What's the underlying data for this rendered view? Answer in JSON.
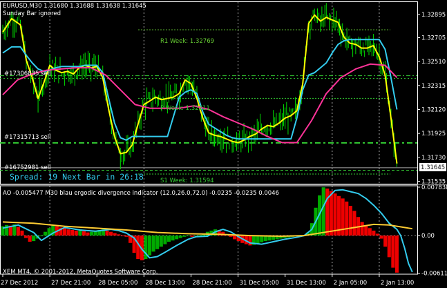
{
  "header": {
    "symbol_line": "EURUSD,M30  1.31680 1.31688 1.31638 1.31645",
    "subtitle": "Sunday Bar ignored"
  },
  "colors": {
    "background": "#000000",
    "grid": "#ffffff",
    "price_bars": "#00dd00",
    "yellow_ma": "#ffff00",
    "cyan_line": "#33ccee",
    "pink_ma": "#ff3399",
    "level_green": "#33cc33",
    "text": "#ffffff",
    "spread_text": "#33ccee",
    "hist_up": "#00aa00",
    "hist_down": "#ee0000",
    "ind_cyan": "#33ccee",
    "ind_yellow": "#ffcc33"
  },
  "labels": {
    "r1_week": "R1 Week: 1.32769",
    "pivot_week": "P Week: 1.32211",
    "s_week": "S1 Week: 1.31594",
    "order1": "#17306835 sell",
    "order2": "#17315713 sell",
    "order3": "#16752981 sell",
    "spread": "Spread: 19  Next Bar in 26:18",
    "current_price": "1.31645"
  },
  "indicator": {
    "title": "AO -0.005477  M30 blau ergodic divergence indicator (12.0,26.0,72.0) -0.0235 -0.0235 0.0046",
    "copyright": "XEM MT4, © 2001-2012, MetaQuotes Software Corp."
  },
  "chart_data": {
    "type": "line",
    "price_axis": {
      "ylim": [
        1.31515,
        1.32995
      ],
      "ticks": [
        {
          "value": 1.32895,
          "label": "1.32895"
        },
        {
          "value": 1.32705,
          "label": "1.32705"
        },
        {
          "value": 1.3251,
          "label": "1.32510"
        },
        {
          "value": 1.32315,
          "label": "1.32315"
        },
        {
          "value": 1.3212,
          "label": "1.32120"
        },
        {
          "value": 1.31925,
          "label": "1.31925"
        },
        {
          "value": 1.3173,
          "label": "1.31730"
        },
        {
          "value": 1.31535,
          "label": "1.31535"
        }
      ]
    },
    "time_axis": {
      "ticks": [
        {
          "t": 0,
          "label": "27 Dec 2012"
        },
        {
          "t": 16,
          "label": "27 Dec 21:00"
        },
        {
          "t": 32,
          "label": "28 Dec 05:00"
        },
        {
          "t": 48,
          "label": "28 Dec 13:00"
        },
        {
          "t": 64,
          "label": "28 Dec 21:00"
        },
        {
          "t": 80,
          "label": "31 Dec 05:00"
        },
        {
          "t": 96,
          "label": "31 Dec 13:00"
        },
        {
          "t": 112,
          "label": "2 Jan 05:00"
        },
        {
          "t": 128,
          "label": "2 Jan 13:00"
        }
      ],
      "vgrid": [
        16,
        48,
        80,
        112,
        128
      ]
    },
    "levels": [
      {
        "name": "r1_week",
        "value": 1.32769
      },
      {
        "name": "pivot_week",
        "value": 1.32211
      },
      {
        "name": "s_week",
        "value": 1.31594
      },
      {
        "name": "order1",
        "value": 1.32395
      },
      {
        "name": "order2",
        "value": 1.31848
      },
      {
        "name": "order3",
        "value": 1.31625
      },
      {
        "name": "current_price",
        "value": 1.31645
      }
    ],
    "price_series": [
      {
        "name": "yellow_ma",
        "points": [
          [
            0,
            1.3275
          ],
          [
            3,
            1.3286
          ],
          [
            6,
            1.3281
          ],
          [
            8,
            1.3252
          ],
          [
            10,
            1.3238
          ],
          [
            12,
            1.3221
          ],
          [
            14,
            1.3234
          ],
          [
            16,
            1.3248
          ],
          [
            18,
            1.3244
          ],
          [
            20,
            1.3242
          ],
          [
            22,
            1.3243
          ],
          [
            24,
            1.3241
          ],
          [
            26,
            1.3246
          ],
          [
            28,
            1.3248
          ],
          [
            30,
            1.3246
          ],
          [
            32,
            1.3247
          ],
          [
            34,
            1.3238
          ],
          [
            36,
            1.3212
          ],
          [
            38,
            1.319
          ],
          [
            40,
            1.3176
          ],
          [
            42,
            1.3177
          ],
          [
            44,
            1.3183
          ],
          [
            46,
            1.32
          ],
          [
            48,
            1.3216
          ],
          [
            50,
            1.3219
          ],
          [
            52,
            1.3222
          ],
          [
            54,
            1.322
          ],
          [
            56,
            1.3221
          ],
          [
            58,
            1.3222
          ],
          [
            60,
            1.3225
          ],
          [
            62,
            1.3236
          ],
          [
            64,
            1.3233
          ],
          [
            66,
            1.3221
          ],
          [
            68,
            1.3205
          ],
          [
            70,
            1.3193
          ],
          [
            72,
            1.3191
          ],
          [
            74,
            1.319
          ],
          [
            76,
            1.3188
          ],
          [
            78,
            1.3186
          ],
          [
            80,
            1.3185
          ],
          [
            82,
            1.3187
          ],
          [
            84,
            1.319
          ],
          [
            86,
            1.3192
          ],
          [
            88,
            1.3196
          ],
          [
            90,
            1.3199
          ],
          [
            92,
            1.3198
          ],
          [
            94,
            1.3201
          ],
          [
            96,
            1.3205
          ],
          [
            98,
            1.3207
          ],
          [
            100,
            1.3211
          ],
          [
            102,
            1.3233
          ],
          [
            104,
            1.3282
          ],
          [
            106,
            1.3289
          ],
          [
            108,
            1.3284
          ],
          [
            110,
            1.3287
          ],
          [
            112,
            1.3285
          ],
          [
            114,
            1.3283
          ],
          [
            116,
            1.3271
          ],
          [
            118,
            1.3266
          ],
          [
            120,
            1.3265
          ],
          [
            122,
            1.3262
          ],
          [
            124,
            1.3262
          ],
          [
            126,
            1.3264
          ],
          [
            128,
            1.3255
          ],
          [
            130,
            1.324
          ],
          [
            132,
            1.3205
          ],
          [
            134,
            1.3168
          ]
        ]
      },
      {
        "name": "cyan_line",
        "points": [
          [
            0,
            1.3258
          ],
          [
            3,
            1.3263
          ],
          [
            6,
            1.3263
          ],
          [
            8,
            1.3256
          ],
          [
            10,
            1.325
          ],
          [
            12,
            1.3245
          ],
          [
            14,
            1.3243
          ],
          [
            16,
            1.3244
          ],
          [
            18,
            1.3246
          ],
          [
            20,
            1.3247
          ],
          [
            22,
            1.3247
          ],
          [
            24,
            1.3247
          ],
          [
            26,
            1.3247
          ],
          [
            28,
            1.3248
          ],
          [
            30,
            1.3248
          ],
          [
            32,
            1.3248
          ],
          [
            34,
            1.3242
          ],
          [
            36,
            1.3221
          ],
          [
            38,
            1.3201
          ],
          [
            40,
            1.3189
          ],
          [
            42,
            1.3187
          ],
          [
            44,
            1.319
          ],
          [
            46,
            1.319
          ],
          [
            48,
            1.319
          ],
          [
            50,
            1.319
          ],
          [
            52,
            1.319
          ],
          [
            54,
            1.319
          ],
          [
            56,
            1.319
          ],
          [
            58,
            1.3206
          ],
          [
            60,
            1.3222
          ],
          [
            62,
            1.3226
          ],
          [
            64,
            1.3228
          ],
          [
            66,
            1.3225
          ],
          [
            68,
            1.321
          ],
          [
            70,
            1.32
          ],
          [
            72,
            1.3197
          ],
          [
            74,
            1.3194
          ],
          [
            76,
            1.3191
          ],
          [
            78,
            1.3189
          ],
          [
            80,
            1.3188
          ],
          [
            82,
            1.3188
          ],
          [
            84,
            1.3188
          ],
          [
            86,
            1.3188
          ],
          [
            88,
            1.3188
          ],
          [
            90,
            1.3188
          ],
          [
            92,
            1.3188
          ],
          [
            94,
            1.3188
          ],
          [
            96,
            1.3188
          ],
          [
            98,
            1.3188
          ],
          [
            100,
            1.3205
          ],
          [
            102,
            1.3228
          ],
          [
            104,
            1.324
          ],
          [
            106,
            1.3242
          ],
          [
            108,
            1.3246
          ],
          [
            110,
            1.325
          ],
          [
            112,
            1.3258
          ],
          [
            114,
            1.3265
          ],
          [
            116,
            1.3268
          ],
          [
            118,
            1.3269
          ],
          [
            120,
            1.3269
          ],
          [
            122,
            1.3269
          ],
          [
            124,
            1.3269
          ],
          [
            126,
            1.3269
          ],
          [
            128,
            1.3269
          ],
          [
            130,
            1.3261
          ],
          [
            132,
            1.3238
          ],
          [
            134,
            1.3212
          ]
        ]
      },
      {
        "name": "pink_ma",
        "points": [
          [
            0,
            1.3224
          ],
          [
            5,
            1.3236
          ],
          [
            10,
            1.3241
          ],
          [
            15,
            1.3244
          ],
          [
            20,
            1.3245
          ],
          [
            25,
            1.3246
          ],
          [
            30,
            1.3246
          ],
          [
            35,
            1.324
          ],
          [
            40,
            1.3228
          ],
          [
            45,
            1.3216
          ],
          [
            50,
            1.3213
          ],
          [
            55,
            1.3213
          ],
          [
            60,
            1.3213
          ],
          [
            65,
            1.3215
          ],
          [
            70,
            1.3212
          ],
          [
            75,
            1.3206
          ],
          [
            80,
            1.3201
          ],
          [
            85,
            1.3196
          ],
          [
            90,
            1.319
          ],
          [
            95,
            1.3185
          ],
          [
            100,
            1.3185
          ],
          [
            105,
            1.3203
          ],
          [
            110,
            1.3225
          ],
          [
            115,
            1.3238
          ],
          [
            120,
            1.3245
          ],
          [
            125,
            1.3249
          ],
          [
            130,
            1.3248
          ],
          [
            134,
            1.3238
          ]
        ]
      }
    ],
    "indicator_axis": {
      "ylim": [
        -0.00625,
        0.00805
      ],
      "ticks": [
        {
          "value": 0.00783,
          "label": "0.007838"
        },
        {
          "value": 0.0,
          "label": "0.00"
        },
        {
          "value": -0.00611,
          "label": "-0.006111"
        }
      ]
    },
    "indicator_histogram": {
      "name": "AO",
      "values": [
        0.0015,
        0.0017,
        0.0016,
        0.0018,
        0.0014,
        0.0008,
        -0.0004,
        -0.001,
        -0.0009,
        -0.0005,
        0.0,
        0.0006,
        0.0012,
        0.0016,
        0.0015,
        0.0013,
        0.0012,
        0.001,
        0.0009,
        0.0008,
        0.0008,
        0.0007,
        0.0005,
        0.0006,
        0.0007,
        0.0009,
        0.001,
        0.0008,
        0.0006,
        0.0004,
        0.0002,
        0.0,
        -0.0002,
        -0.0012,
        -0.0028,
        -0.0038,
        -0.004,
        -0.0038,
        -0.0032,
        -0.0026,
        -0.0022,
        -0.0018,
        -0.0014,
        -0.001,
        -0.0008,
        -0.0006,
        -0.0004,
        -0.0002,
        0.0,
        -0.0002,
        -0.0001,
        0.0001,
        0.0003,
        0.0006,
        0.0008,
        0.001,
        0.0009,
        0.0006,
        0.0002,
        -0.0002,
        -0.0006,
        -0.0009,
        -0.0012,
        -0.0014,
        -0.0016,
        -0.0015,
        -0.0013,
        -0.0011,
        -0.0009,
        -0.0008,
        -0.0007,
        -0.0006,
        -0.0005,
        -0.0004,
        -0.0003,
        -0.0002,
        -0.0001,
        0.0,
        0.0001,
        0.0005,
        0.002,
        0.0045,
        0.0065,
        0.0078,
        0.0076,
        0.0072,
        0.0068,
        0.0064,
        0.006,
        0.0055,
        0.0048,
        0.004,
        0.003,
        0.0022,
        0.0016,
        0.0012,
        0.0008,
        0.0003,
        -0.0005,
        -0.0018,
        -0.0035,
        -0.0052,
        -0.006
      ]
    },
    "indicator_series": [
      {
        "name": "ind_cyan",
        "points": [
          [
            0,
            0.0012
          ],
          [
            4,
            0.0017
          ],
          [
            8,
            0.0005
          ],
          [
            10,
            -0.0008
          ],
          [
            13,
            0.0004
          ],
          [
            16,
            0.0013
          ],
          [
            20,
            0.0009
          ],
          [
            24,
            0.0007
          ],
          [
            28,
            0.001
          ],
          [
            30,
            0.0008
          ],
          [
            32,
            0.0004
          ],
          [
            34,
            -0.0004
          ],
          [
            36,
            -0.0022
          ],
          [
            38,
            -0.0036
          ],
          [
            40,
            -0.0034
          ],
          [
            42,
            -0.0027
          ],
          [
            45,
            -0.0016
          ],
          [
            48,
            -0.0006
          ],
          [
            50,
            -0.0002
          ],
          [
            53,
            -0.0001
          ],
          [
            55,
            0.0006
          ],
          [
            57,
            0.001
          ],
          [
            59,
            0.0006
          ],
          [
            61,
            -0.0002
          ],
          [
            64,
            -0.0012
          ],
          [
            67,
            -0.0014
          ],
          [
            70,
            -0.001
          ],
          [
            73,
            -0.0006
          ],
          [
            76,
            -0.0003
          ],
          [
            78,
            0.0
          ],
          [
            80,
            0.001
          ],
          [
            82,
            0.0035
          ],
          [
            84,
            0.006
          ],
          [
            86,
            0.0073
          ],
          [
            88,
            0.0074
          ],
          [
            90,
            0.0071
          ],
          [
            92,
            0.0068
          ],
          [
            94,
            0.006
          ],
          [
            96,
            0.0049
          ],
          [
            98,
            0.0036
          ],
          [
            100,
            0.002
          ],
          [
            102,
            0.001
          ],
          [
            103,
            0.0
          ],
          [
            104,
            -0.002
          ],
          [
            105,
            -0.0045
          ],
          [
            106,
            -0.0059
          ]
        ]
      },
      {
        "name": "ind_yellow",
        "points": [
          [
            0,
            0.0022
          ],
          [
            8,
            0.002
          ],
          [
            16,
            0.0015
          ],
          [
            24,
            0.0012
          ],
          [
            32,
            0.0009
          ],
          [
            40,
            0.0005
          ],
          [
            48,
            0.0003
          ],
          [
            56,
            0.0002
          ],
          [
            64,
            0.0
          ],
          [
            72,
            -0.0001
          ],
          [
            78,
            0.0
          ],
          [
            84,
            0.0006
          ],
          [
            90,
            0.0012
          ],
          [
            96,
            0.0018
          ],
          [
            100,
            0.0017
          ],
          [
            104,
            0.0013
          ],
          [
            106,
            0.0011
          ]
        ]
      }
    ]
  }
}
